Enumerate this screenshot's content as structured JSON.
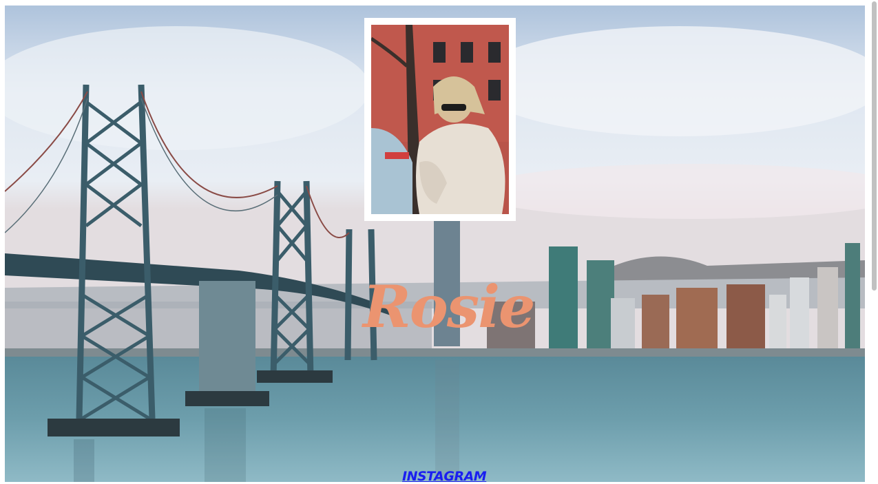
{
  "profile": {
    "name": "Rosie"
  },
  "links": {
    "instagram_label": "INSTAGRAM"
  },
  "colors": {
    "name_color": "#eb9470",
    "link_color": "#1a1ef0"
  },
  "icons": {
    "background": "san-francisco-bay-bridge-photo",
    "portrait": "profile-photo"
  }
}
